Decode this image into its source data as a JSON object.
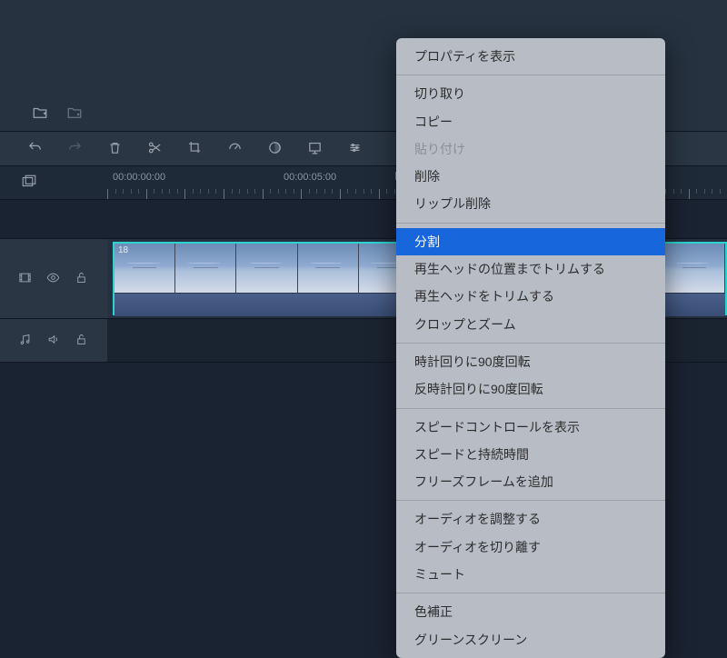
{
  "timeline": {
    "timecode0": "00:00:00:00",
    "timecode1": "00:00:05:00"
  },
  "clip": {
    "frame_num": "18"
  },
  "ctx": {
    "show_properties": "プロパティを表示",
    "cut": "切り取り",
    "copy": "コピー",
    "paste": "貼り付け",
    "delete": "削除",
    "ripple_delete": "リップル削除",
    "split": "分割",
    "trim_to_playhead": "再生ヘッドの位置までトリムする",
    "trim_playhead": "再生ヘッドをトリムする",
    "crop_zoom": "クロップとズーム",
    "rot_cw": "時計回りに90度回転",
    "rot_ccw": "反時計回りに90度回転",
    "speed_ctrl": "スピードコントロールを表示",
    "speed_dur": "スピードと持続時間",
    "freeze": "フリーズフレームを追加",
    "audio_adj": "オーディオを調整する",
    "audio_detach": "オーディオを切り離す",
    "mute": "ミュート",
    "color_correct": "色補正",
    "green_screen": "グリーンスクリーン"
  }
}
